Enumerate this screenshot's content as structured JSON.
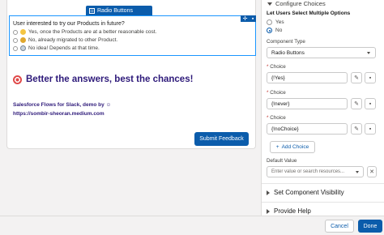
{
  "canvas": {
    "component_badge": "Radio Buttons",
    "question": "User interested to try our Products in future?",
    "options": [
      "Yes, once the Products are at a better reasonable cost.",
      "No, already migrated to other Product.",
      "No idea! Depends at that time."
    ],
    "headline": "Better the answers, best the chances!",
    "signature_line1": "Salesforce Flows for Slack, demo by ☺",
    "signature_line2": "https://sombir-sheoran.medium.com",
    "submit_label": "Submit Feedback",
    "tool_move": "✛",
    "tool_delete": "🗑"
  },
  "panel": {
    "section_title": "Configure Choices",
    "multi_select_label": "Let Users Select Multiple Options",
    "yes_label": "Yes",
    "no_label": "No",
    "selected_option": "No",
    "component_type_label": "Component Type",
    "component_type_value": "Radio Buttons",
    "choice_label": "Choice",
    "required_marker": "*",
    "choices": [
      "{!Yes}",
      "{!never}",
      "{!noChoice}"
    ],
    "add_choice_label": "Add Choice",
    "default_value_label": "Default Value",
    "default_value_placeholder": "Enter value or search resources...",
    "visibility_section": "Set Component Visibility",
    "help_section": "Provide Help"
  },
  "footer": {
    "cancel_label": "Cancel",
    "done_label": "Done"
  },
  "colors": {
    "brand": "#0b5cab",
    "selection": "#1b96ff",
    "headline": "#2e1a7a"
  }
}
